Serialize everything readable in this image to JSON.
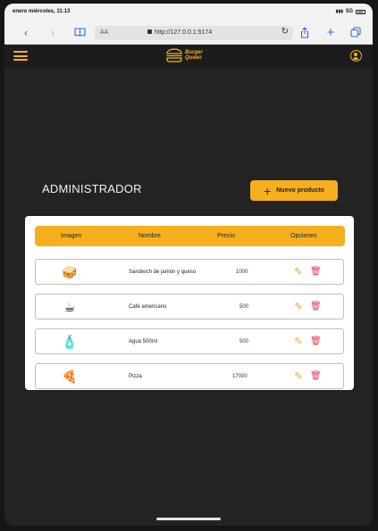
{
  "status_bar": {
    "time": "enero miércoles, 11:13",
    "signal": "5G"
  },
  "browser": {
    "reader_label": "AA",
    "url": "http://127.0.0.1:5174"
  },
  "app": {
    "logo_line1": "Burger",
    "logo_line2": "Queen",
    "accent": "#f6b01d"
  },
  "page": {
    "title": "ADMINISTRADOR",
    "new_product_label": "Nuevo producto"
  },
  "table": {
    "headers": [
      "Imagen",
      "Nombre",
      "Precio",
      "Opciones"
    ],
    "rows": [
      {
        "name": "Sandwich de jamón y queso",
        "price": "1000",
        "icon": "sandwich-icon"
      },
      {
        "name": "Café americano",
        "price": "500",
        "icon": "coffee-icon"
      },
      {
        "name": "Agua 500ml",
        "price": "500",
        "icon": "water-bottle-icon"
      },
      {
        "name": "Pizza",
        "price": "17000",
        "icon": "pizza-icon"
      }
    ]
  }
}
